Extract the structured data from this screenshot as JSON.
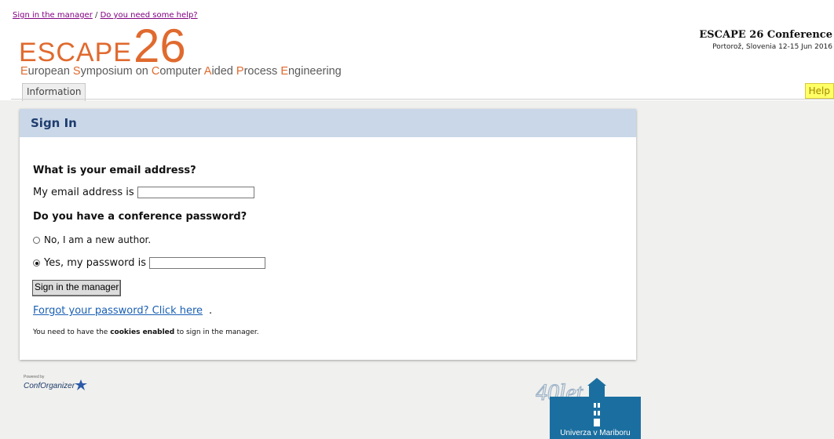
{
  "top_links": {
    "sign_in": "Sign in the manager",
    "separator": " / ",
    "help": "Do you need some help?"
  },
  "logo": {
    "word": "ESCAPE",
    "number": "26",
    "subtitle_parts": [
      {
        "t": "E",
        "hl": true
      },
      {
        "t": "uropean ",
        "hl": false
      },
      {
        "t": "S",
        "hl": true
      },
      {
        "t": "ymposium on ",
        "hl": false
      },
      {
        "t": "C",
        "hl": true
      },
      {
        "t": "omputer ",
        "hl": false
      },
      {
        "t": "A",
        "hl": true
      },
      {
        "t": "ided ",
        "hl": false
      },
      {
        "t": "P",
        "hl": true
      },
      {
        "t": "rocess ",
        "hl": false
      },
      {
        "t": "E",
        "hl": true
      },
      {
        "t": "ngineering",
        "hl": false
      }
    ]
  },
  "conference": {
    "title": "ESCAPE 26 Conference",
    "subtitle": "Portorož, Slovenia 12-15 Jun 2016"
  },
  "tabs": {
    "information": "Information",
    "help": "Help"
  },
  "panel": {
    "title": "Sign In",
    "email_question": "What is your email address?",
    "email_label": "My email address is",
    "email_value": "",
    "password_question": "Do you have a conference password?",
    "option_new": "No, I am a new author.",
    "option_yes": "Yes, my password is",
    "password_value": "",
    "submit": "Sign in the manager",
    "forgot": "Forgot your password? Click here",
    "forgot_dot": ".",
    "note_prefix": "You need to have the ",
    "note_bold": "cookies enabled",
    "note_suffix": " to sign in the manager."
  },
  "footer": {
    "powered_small": "Powered by",
    "powered_brand": "ConfOrganizer",
    "university": "Univerza v Mariboru",
    "university_badge": "40let"
  },
  "colors": {
    "accent": "#e06a2e",
    "header_band": "#c9d7e8",
    "link": "#1a5fb4",
    "visited_link": "#800080",
    "help_tab": "#ffff66"
  }
}
